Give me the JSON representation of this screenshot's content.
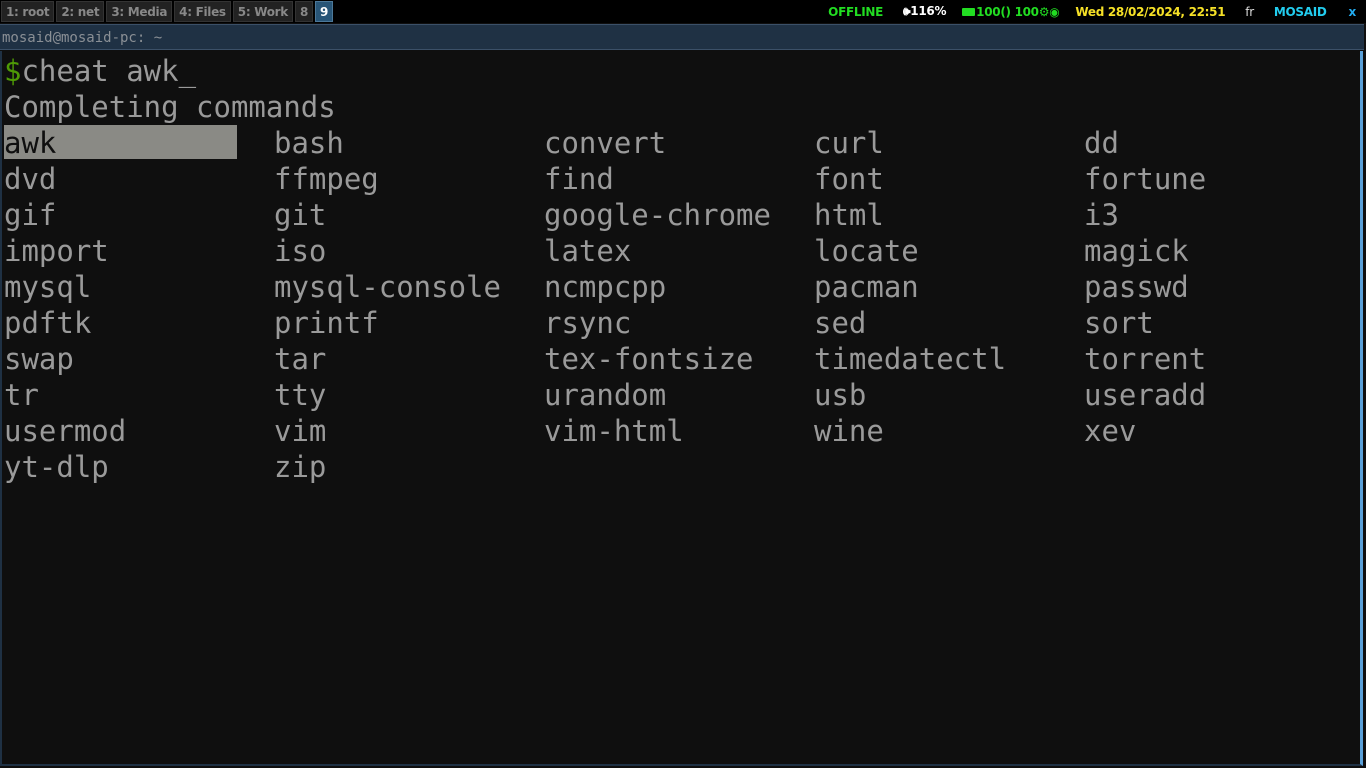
{
  "bar": {
    "workspaces": [
      {
        "label": "1: root",
        "focused": false
      },
      {
        "label": "2: net",
        "focused": false
      },
      {
        "label": "3: Media",
        "focused": false
      },
      {
        "label": "4: Files",
        "focused": false
      },
      {
        "label": "5: Work",
        "focused": false
      },
      {
        "label": "8",
        "focused": false
      },
      {
        "label": "9",
        "focused": true
      }
    ],
    "status": {
      "network": "OFFLINE",
      "volume_icon": "speaker-icon",
      "volume": "116%",
      "battery_icon": "battery-icon",
      "battery": "100() 100",
      "extra_icons": [
        "gear-icon",
        "eye-icon"
      ],
      "datetime": "Wed 28/02/2024, 22:51",
      "keyboard_layout": "fr",
      "user": "MOSAID",
      "close": "x"
    },
    "colors": {
      "online_green": "#22dd22",
      "date_yellow": "#f5e027",
      "user_cyan": "#22ccee",
      "focused_ws": "#285577"
    }
  },
  "window": {
    "title": "mosaid@mosaid-pc: ~"
  },
  "terminal": {
    "prompt_symbol": "$",
    "command": "cheat awk",
    "cursor": "_",
    "completion_header": "Completing commands",
    "selected_index": 0,
    "columns": 5,
    "completions": [
      "awk",
      "bash",
      "convert",
      "curl",
      "dd",
      "dvd",
      "ffmpeg",
      "find",
      "font",
      "fortune",
      "gif",
      "git",
      "google-chrome",
      "html",
      "i3",
      "import",
      "iso",
      "latex",
      "locate",
      "magick",
      "mysql",
      "mysql-console",
      "ncmpcpp",
      "pacman",
      "passwd",
      "pdftk",
      "printf",
      "rsync",
      "sed",
      "sort",
      "swap",
      "tar",
      "tex-fontsize",
      "timedatectl",
      "torrent",
      "tr",
      "tty",
      "urandom",
      "usb",
      "useradd",
      "usermod",
      "vim",
      "vim-html",
      "wine",
      "xev",
      "yt-dlp",
      "zip"
    ]
  }
}
